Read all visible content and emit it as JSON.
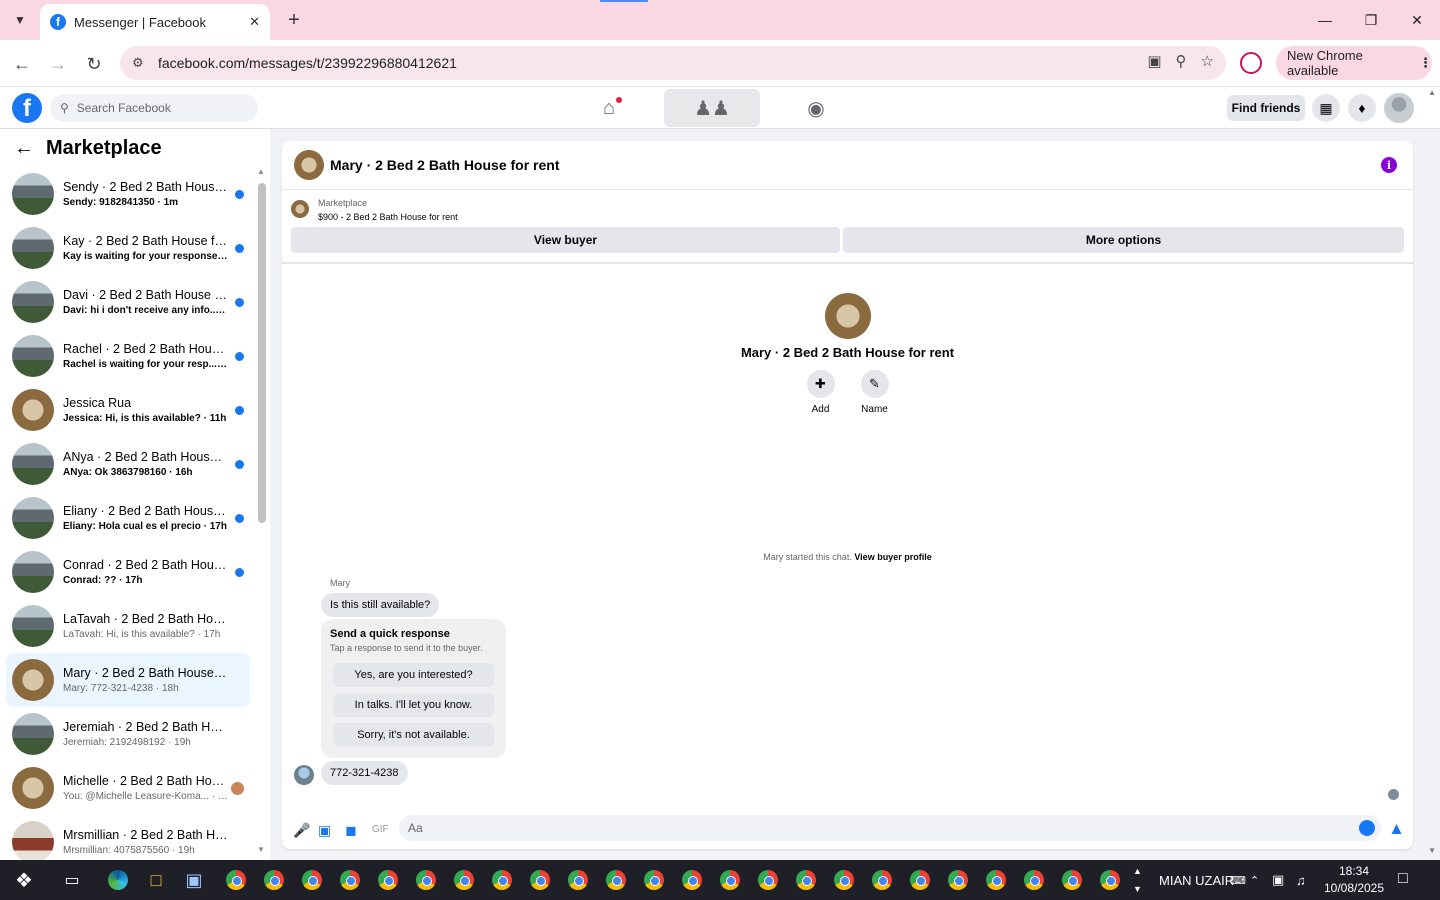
{
  "browser": {
    "tab_title": "Messenger | Facebook",
    "url": "facebook.com/messages/t/23992296880412621",
    "update_label": "New Chrome available"
  },
  "fb": {
    "search_placeholder": "Search Facebook",
    "find_friends": "Find friends",
    "brand_color": "#1877f2"
  },
  "sidebar": {
    "title": "Marketplace",
    "conversations": [
      {
        "name": "Sendy · 2 Bed 2 Bath House f...",
        "preview": "Sendy: 9182841350 · 1m",
        "unread": true,
        "thumb": "house"
      },
      {
        "name": "Kay · 2 Bed 2 Bath House for r...",
        "preview": "Kay is waiting for your response. · 1h",
        "unread": true,
        "thumb": "house"
      },
      {
        "name": "Davi · 2 Bed 2 Bath House for ...",
        "preview": "Davi: hi i don't receive any info... · 2h",
        "unread": true,
        "thumb": "house"
      },
      {
        "name": "Rachel · 2 Bed 2 Bath House f...",
        "preview": "Rachel is waiting for your resp... · 7h",
        "unread": true,
        "thumb": "house"
      },
      {
        "name": "Jessica Rua",
        "preview": "Jessica: Hi, is this available? · 11h",
        "unread": true,
        "thumb": "door"
      },
      {
        "name": "ANya · 2 Bed 2 Bath House fo...",
        "preview": "ANya: Ok 3863798160 · 16h",
        "unread": true,
        "thumb": "house"
      },
      {
        "name": "Eliany · 2 Bed 2 Bath House fo...",
        "preview": "Eliany: Hola cual es el precio · 17h",
        "unread": true,
        "thumb": "house"
      },
      {
        "name": "Conrad · 2 Bed 2 Bath House ...",
        "preview": "Conrad: ?? · 17h",
        "unread": true,
        "thumb": "house"
      },
      {
        "name": "LaTavah · 2 Bed 2 Bath House f...",
        "preview": "LaTavah: Hi, is this available? · 17h",
        "unread": false,
        "thumb": "house"
      },
      {
        "name": "Mary · 2 Bed 2 Bath House for r...",
        "preview": "Mary: 772-321-4238 · 18h",
        "unread": false,
        "thumb": "door",
        "selected": true
      },
      {
        "name": "Jeremiah · 2 Bed 2 Bath House f...",
        "preview": "Jeremiah: 2192498192 · 19h",
        "unread": false,
        "thumb": "house"
      },
      {
        "name": "Michelle · 2 Bed 2 Bath Hous...",
        "preview": "You: @Michelle Leasure-Koma... · 19h",
        "unread": false,
        "thumb": "door",
        "seen_avatar": true
      },
      {
        "name": "Mrsmillian · 2 Bed 2 Bath Hous...",
        "preview": "Mrsmillian: 4075875560 · 19h",
        "unread": false,
        "thumb": "room"
      }
    ]
  },
  "chat": {
    "title": "Mary · 2 Bed 2 Bath House for rent",
    "listing_category": "Marketplace",
    "listing_title": "$900 - 2 Bed 2 Bath House for rent",
    "view_buyer": "View buyer",
    "more_options": "More options",
    "profile_name": "Mary · 2 Bed 2 Bath House for rent",
    "add_label": "Add",
    "name_label": "Name",
    "system_message": "Mary started this chat.",
    "view_buyer_profile": "View buyer profile",
    "sender": "Mary",
    "first_message": "Is this still available?",
    "quick_title": "Send a quick response",
    "quick_subtitle": "Tap a response to send it to the buyer.",
    "quick_replies": [
      "Yes, are you interested?",
      "In talks. I'll let you know.",
      "Sorry, it's not available."
    ],
    "phone_message": "772-321-4238",
    "composer_placeholder": "Aa"
  },
  "taskbar": {
    "user": "MIAN UZAIR",
    "time": "18:34",
    "date": "10/08/2025"
  }
}
